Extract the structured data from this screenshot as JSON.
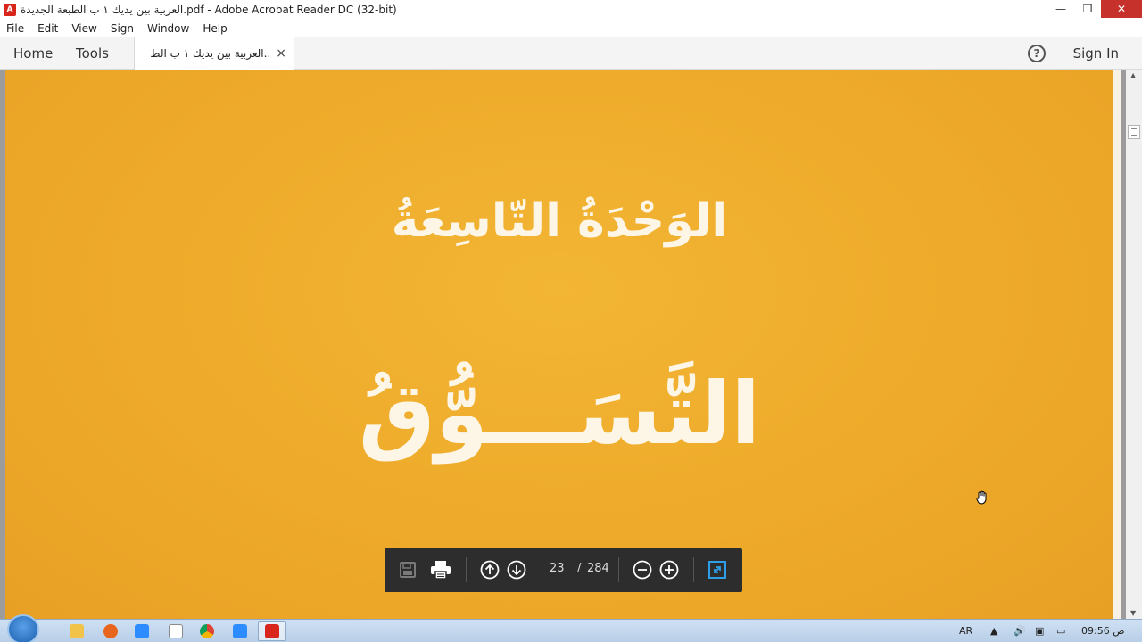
{
  "window": {
    "title": "العربية بين يديك ١ ب الطبعة الجديدة.pdf - Adobe Acrobat Reader DC (32-bit)",
    "controls": {
      "minimize": "—",
      "restore": "❐",
      "close": "✕"
    }
  },
  "menu": {
    "items": [
      "File",
      "Edit",
      "View",
      "Sign",
      "Window",
      "Help"
    ]
  },
  "tabs": {
    "home": "Home",
    "tools": "Tools",
    "document": "العربية بين يديك ١ ب الط..",
    "close": "×"
  },
  "header": {
    "help": "?",
    "sign_in": "Sign In"
  },
  "page_content": {
    "heading": "الوَحْدَةُ التّاسِعَةُ",
    "subheading": "التَّسَـــوُّقُ"
  },
  "toolbar": {
    "current_page": "23",
    "separator": "/",
    "total_pages": "284",
    "icons": [
      "save-icon",
      "print-icon",
      "previous-page-icon",
      "next-page-icon",
      "zoom-out-icon",
      "zoom-in-icon",
      "fit-page-icon"
    ]
  },
  "taskbar": {
    "apps": [
      "file-explorer",
      "firefox",
      "zoom",
      "documents",
      "chrome",
      "zoom",
      "acrobat-reader"
    ],
    "language": "AR",
    "clock": "09:56 ص"
  },
  "colors": {
    "page": "#eeaa2a",
    "toolbar": "#2d2d2d",
    "close_button": "#c7312b"
  }
}
